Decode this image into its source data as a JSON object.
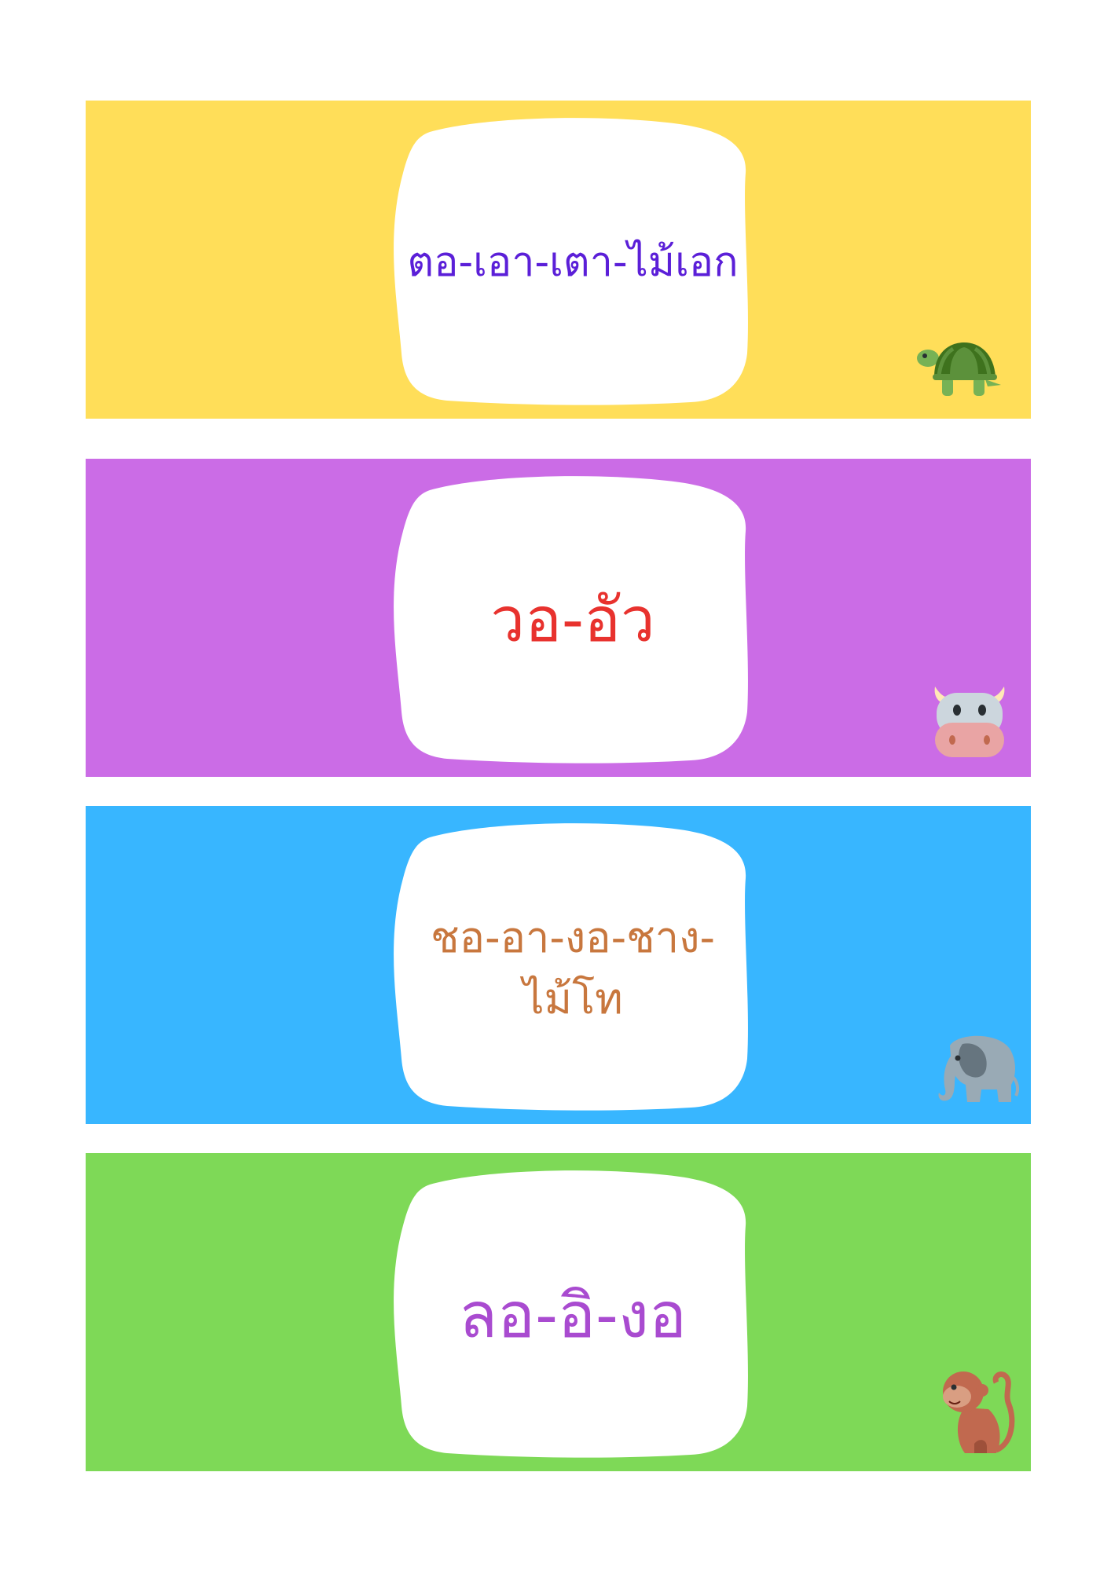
{
  "cards": [
    {
      "word": "ตอ-เอา-เตา-ไม้เอก",
      "text_color": "#5b1fd8",
      "bg_color": "#ffde59",
      "animal": "turtle-icon"
    },
    {
      "word": "วอ-อัว",
      "text_color": "#e8322e",
      "bg_color": "#cb6ce6",
      "animal": "cow-icon"
    },
    {
      "word_line1": "ชอ-อา-งอ-ชาง-",
      "word_line2": "ไม้โท",
      "text_color": "#c8773e",
      "bg_color": "#38b6ff",
      "animal": "elephant-icon"
    },
    {
      "word": "ลอ-อิ-งอ",
      "text_color": "#a94bd0",
      "bg_color": "#7ed957",
      "animal": "monkey-icon"
    }
  ]
}
